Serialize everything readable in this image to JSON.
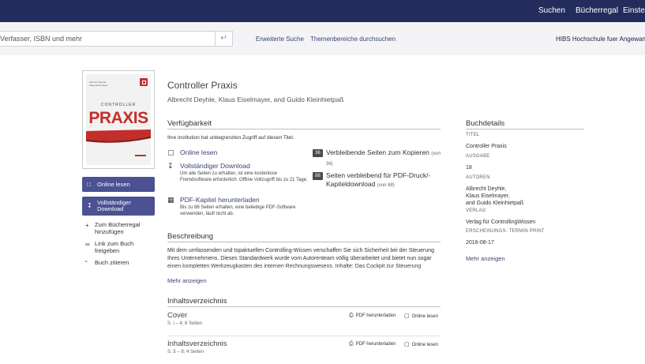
{
  "header": {
    "nav": [
      "Suchen",
      "Bücherregal",
      "Einstellu"
    ]
  },
  "search": {
    "placeholder": "Verfasser, ISBN und mehr",
    "submit_icon": "enter-arrow-icon",
    "links": [
      "Erweiterte Suche",
      "Themenbereiche durchsuchen"
    ],
    "institution": "HIBS Hochschule fuer Angewand"
  },
  "cover": {
    "small_text": "Albrecht Deyhle · Klaus Eiselmayer",
    "supertitle": "CONTROLLER",
    "title": "PRAXIS",
    "accent_color": "#c42e2a"
  },
  "sidebar": {
    "online_button": "Online lesen",
    "download_button": "Vollständiger Download",
    "links": [
      "Zum Bücherregal hinzufügen",
      "Link zum Buch freigeben",
      "Buch zitieren"
    ]
  },
  "book": {
    "title": "Controller Praxis",
    "authors": "Albrecht Deyhle, Klaus Eiselmayer, and Guido Kleinhietpaß"
  },
  "availability": {
    "heading": "Verfügbarkeit",
    "note": "Ihre Institution hat unbegrenzten Zugriff auf diesen Titel.",
    "items": [
      {
        "title": "Online lesen",
        "desc": "",
        "icon": "book-icon"
      },
      {
        "title": "Vollständiger Download",
        "desc": "Um alle Seiten zu erhalten, ist eine kostenlose Fremdsoftware erforderlich. Offline Vollzugriff bis zu 21 Tage.",
        "icon": "download-icon"
      },
      {
        "title": "PDF-Kapitel herunterladen",
        "desc": "Bis zu 88 Seiten erhalten, eine beliebige PDF-Software verwenden, läuft nicht ab.",
        "icon": "pdf-icon"
      }
    ],
    "counts": [
      {
        "value": "36",
        "label": "Verbleibende Seiten zum Kopieren",
        "sub": "(von 36)"
      },
      {
        "value": "88",
        "label": "Seiten verbleibend für PDF-Druck/-Kapiteldownload",
        "sub": "(von 88)"
      }
    ]
  },
  "description": {
    "heading": "Beschreibung",
    "text": "Mit dem umfassenden und topaktuellen Controlling-Wissen verschaffen Sie sich Sicherheit bei der Steuerung Ihres Unternehmens. Dieses Standardwerk wurde vom Autorenteam völlig überarbeitet und bietet nun sogar einen kompletten Werkzeugkasten des internen Rechnungswesens. Inhalte: Das Cockpit zur Steuerung",
    "more": "Mehr anzeigen"
  },
  "toc": {
    "heading": "Inhaltsverzeichnis",
    "download_label": "PDF herunterladen",
    "online_label": "Online lesen",
    "entries": [
      {
        "title": "Cover",
        "pages": "S. i – 4; 6 Seiten"
      },
      {
        "title": "Inhaltsverzeichnis",
        "pages": "S. 5 – 8; 4 Seiten"
      }
    ]
  },
  "details": {
    "heading": "Buchdetails",
    "fields": [
      {
        "label": "TITEL",
        "value": "Controller Praxis"
      },
      {
        "label": "AUSGABE",
        "value": "18"
      },
      {
        "label": "AUTOREN",
        "value": "Albrecht Deyhle,\nKlaus Eiselmayer,\nand Guido Kleinhietpaß"
      },
      {
        "label": "VERLAG",
        "value": "Verlag für ControllingWissen"
      },
      {
        "label": "ERSCHEINUNGS- TERMIN PRINT",
        "value": "2016-08-17"
      }
    ],
    "more": "Mehr anzeigen"
  }
}
